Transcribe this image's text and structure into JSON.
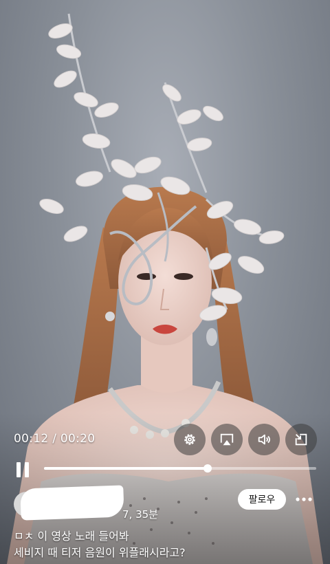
{
  "player": {
    "current_time": "00:12",
    "duration": "00:20",
    "time_display": "00:12 / 00:20",
    "progress_fraction": 0.6
  },
  "controls": {
    "settings_icon": "gear-icon",
    "airplay_icon": "airplay-icon",
    "volume_icon": "speaker-icon",
    "pip_icon": "picture-in-picture-icon",
    "pause_icon": "pause-icon"
  },
  "post": {
    "author_suffix": "7, 35분",
    "follow_label": "팔로우",
    "more_icon": "more-dots-icon",
    "caption_line1": "ㅁㅊ 이 영상 노래 들어봐",
    "caption_line2": "세비지 때 티저 음원이 위플래시라고?"
  },
  "colors": {
    "background": "#8a9099",
    "follow_button_bg": "#ffffff",
    "text": "#ffffff"
  }
}
